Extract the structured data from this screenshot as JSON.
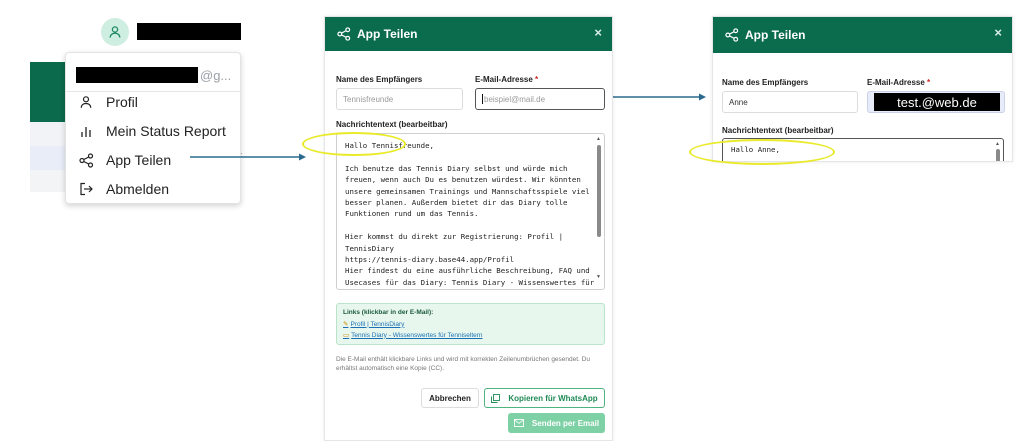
{
  "user_menu": {
    "email_suffix": "@g...",
    "items": [
      {
        "label": "Profil",
        "icon": "user-icon"
      },
      {
        "label": "Mein Status Report",
        "icon": "bar-chart-icon"
      },
      {
        "label": "App Teilen",
        "icon": "share-icon"
      },
      {
        "label": "Abmelden",
        "icon": "logout-icon"
      }
    ],
    "partial_char": "/",
    "partial_char2": "r"
  },
  "dialog1": {
    "title": "App Teilen",
    "close": "×",
    "recipient_label": "Name des Empfängers",
    "recipient_placeholder": "Tennisfreunde",
    "email_label": "E-Mail-Adresse",
    "email_required": "*",
    "email_placeholder": "beispiel@mail.de",
    "message_label": "Nachrichtentext (bearbeitbar)",
    "message": "Hallo Tennisfreunde,\n\nIch benutze das Tennis Diary selbst und würde mich freuen, wenn auch Du es benutzen würdest. Wir könnten unsere gemeinsamen Trainings und Mannschaftsspiele viel besser planen. Außerdem bietet dir das Diary tolle Funktionen rund um das Tennis.\n\nHier kommst du direkt zur Registrierung: Profil | TennisDiary\nhttps://tennis-diary.base44.app/Profil\nHier findest du eine ausführliche Beschreibung, FAQ und Usecases für das Diary: Tennis Diary - Wissenswertes für Tenniseltern",
    "links_title": "Links (klickbar in der E-Mail):",
    "links": [
      "Profil | TennisDiary",
      "Tennis Diary - Wissenswertes für Tenniseltern"
    ],
    "note": "Die E-Mail enthält klickbare Links und wird mit korrekten Zeilenumbrüchen gesendet. Du erhältst automatisch eine Kopie (CC).",
    "cancel": "Abbrechen",
    "whatsapp": "Kopieren für WhatsApp",
    "send": "Senden per Email"
  },
  "dialog2": {
    "title": "App Teilen",
    "close": "×",
    "recipient_label": "Name des Empfängers",
    "recipient_value": "Anne",
    "email_label": "E-Mail-Adresse",
    "email_required": "*",
    "email_value": "test.@web.de",
    "message_label": "Nachrichtentext (bearbeitbar)",
    "message": "Hallo Anne,"
  },
  "colors": {
    "header_green": "#0a6b4d",
    "annotation_arrow": "#2a6a8e",
    "highlight_yellow": "#e9ea2a"
  }
}
